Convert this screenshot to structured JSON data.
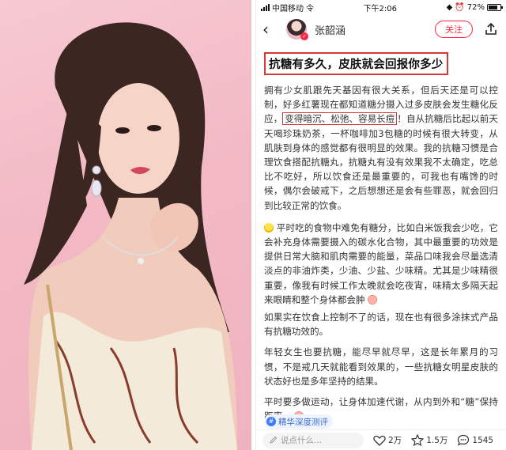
{
  "status_bar": {
    "carrier": "中国移动",
    "network": "令",
    "time": "下午2:06",
    "battery": "72%"
  },
  "navbar": {
    "back_icon": "‹",
    "author": "张韶涵",
    "verified_badge": "✓",
    "follow_label": "关注"
  },
  "post": {
    "title": "抗糖有多久，皮肤就会回报你多少",
    "p1_before": "拥有少女肌跟先天基因有很大关系，但后天还是可以控制，好多红薯现在都知道糖分摄入过多皮肤会发生糖化反应，",
    "p1_highlight": "变得暗沉、松弛、容易长痘",
    "p1_after": "！自从抗糖后比起以前天天喝珍珠奶茶，一杯咖啡加3包糖的时候有很大转变，从肌肤到身体的感觉都有很明显的效果。我的抗糖习惯是合理饮食搭配抗糖丸，抗糖丸有没有效果我不太确定，吃总比不吃好，所以饮食还是最重要的，可我也有嘴馋的时候，偶尔会破戒下，之后想想还是会有些罪恶，就会回归到比较正常的饮食。",
    "p2_text": "平时吃的食物中难免有糖分，比如白米饭我会少吃，它会补充身体需要摄入的碳水化合物，其中最重要的功效是提供日常大脑和肌肉需要的能量，菜品口味我会尽量选清淡点的非油炸类，少油、少盐、少味精。尤其是少味精很重要，像我有时候工作太晚就会吃夜宵，味精太多隔天起来眼睛和整个身体都会肿",
    "p3": "如果实在饮食上控制不了的话，现在也有很多涂抹式产品有抗糖功效的。",
    "p4": "年轻女生也要抗糖，能尽早就尽早，这是长年累月的习惯，不是戒几天就能看到效果的，一些抗糖女明星皮肤的状态好也是多年坚持的结果。",
    "p5": "平时要多做运动，让身体加速代谢，从内到外和“糖”保持距离～",
    "tag": "精华深度测评",
    "tag_icon": "#"
  },
  "bottom_bar": {
    "comment_placeholder": "说点什么...",
    "likes": "2万",
    "favorites": "1.5万",
    "comments": "1545"
  },
  "colors": {
    "accent_red": "#ff2442",
    "highlight_box": "#d23a3a",
    "photo_bg": "#f2b9c5"
  },
  "icons": [
    "signal-icon",
    "wifi-icon",
    "battery-icon",
    "back-icon",
    "share-icon",
    "heart-icon",
    "star-icon",
    "comment-icon",
    "pencil-icon",
    "bulb-emoji-icon",
    "pig-emoji-icon"
  ]
}
